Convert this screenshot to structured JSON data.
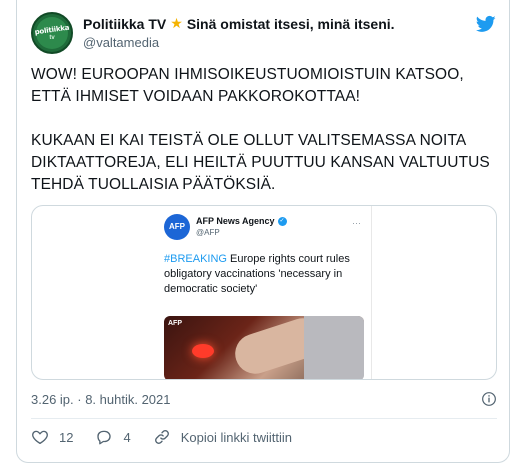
{
  "author": {
    "display_name": "Politiikka TV",
    "bio_suffix": "Sinä omistat itsesi, minä itseni.",
    "handle": "@valtamedia",
    "avatar_text": "politiikka",
    "avatar_sub": "tv"
  },
  "tweet": {
    "text": "WOW! EUROOPAN IHMISOIKEUSTUOMIOISTUIN KATSOO, ETTÄ IHMISET VOIDAAN PAKKOROKOTTAA!\n\nKUKAAN EI KAI TEISTÄ OLE OLLUT VALITSEMASSA NOITA DIKTAATTOREJA, ELI HEILTÄ PUUTTUU KANSAN VALTUUTUS TEHDÄ TUOLLAISIA PÄÄTÖKSIÄ.",
    "timestamp": "3.26 ip. · 8. huhtik. 2021"
  },
  "embedded": {
    "logo_text": "AFP",
    "name": "AFP News Agency",
    "handle": "@AFP",
    "hashtag": "#BREAKING",
    "text": " Europe rights court rules obligatory vaccinations 'necessary in democratic society'",
    "photo_watermark": "AFP"
  },
  "actions": {
    "likes": "12",
    "replies": "4",
    "copy_link": "Kopioi linkki twiittiin"
  },
  "colors": {
    "text": "#0f1419",
    "secondary": "#536471",
    "accent": "#1d9bf0",
    "star": "#f5b301"
  },
  "icons": [
    "twitter-bird-icon",
    "star-icon",
    "verified-icon",
    "info-icon",
    "heart-icon",
    "reply-icon",
    "link-icon"
  ]
}
